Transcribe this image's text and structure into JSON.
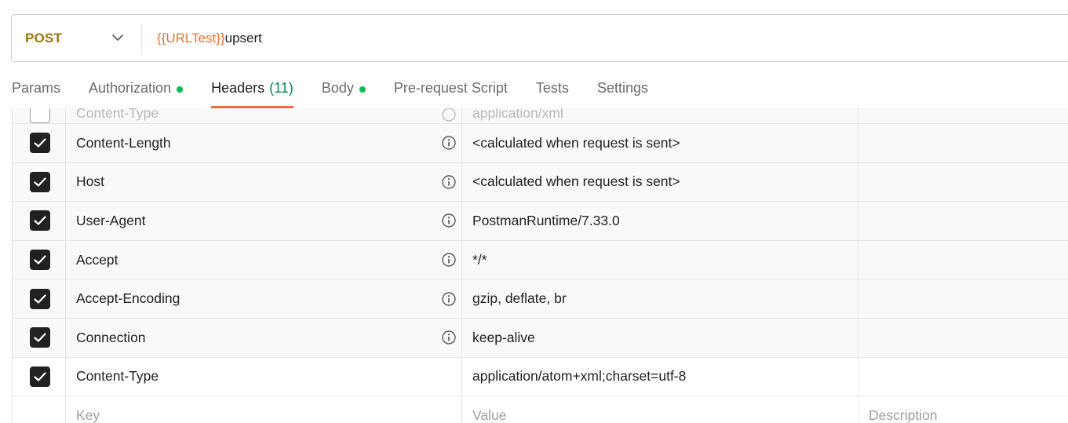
{
  "request": {
    "method": "POST",
    "url_variable": "{{URLTest}}",
    "url_path": "upsert"
  },
  "tabs": [
    {
      "label": "Params",
      "count": "",
      "dot": false,
      "active": false
    },
    {
      "label": "Authorization",
      "count": "",
      "dot": true,
      "active": false
    },
    {
      "label": "Headers",
      "count": "(11)",
      "dot": false,
      "active": true
    },
    {
      "label": "Body",
      "count": "",
      "dot": true,
      "active": false
    },
    {
      "label": "Pre-request Script",
      "count": "",
      "dot": false,
      "active": false
    },
    {
      "label": "Tests",
      "count": "",
      "dot": false,
      "active": false
    },
    {
      "label": "Settings",
      "count": "",
      "dot": false,
      "active": false
    }
  ],
  "headers_partial": {
    "key": "Content-Type",
    "value": "application/xml",
    "checked": false
  },
  "headers": [
    {
      "key": "Content-Length",
      "value": "<calculated when request is sent>",
      "checked": true,
      "info": true
    },
    {
      "key": "Host",
      "value": "<calculated when request is sent>",
      "checked": true,
      "info": true
    },
    {
      "key": "User-Agent",
      "value": "PostmanRuntime/7.33.0",
      "checked": true,
      "info": true
    },
    {
      "key": "Accept",
      "value": "*/*",
      "checked": true,
      "info": true
    },
    {
      "key": "Accept-Encoding",
      "value": "gzip, deflate, br",
      "checked": true,
      "info": true
    },
    {
      "key": "Connection",
      "value": "keep-alive",
      "checked": true,
      "info": true
    },
    {
      "key": "Content-Type",
      "value": "application/atom+xml;charset=utf-8",
      "checked": true,
      "info": false
    }
  ],
  "new_row": {
    "key_placeholder": "Key",
    "value_placeholder": "Value",
    "description_placeholder": "Description"
  },
  "colors": {
    "method": "#a0760b",
    "variable": "#f2702f",
    "active_tab_underline": "#f26b3a",
    "status_dot": "#0cbb52",
    "count": "#0a8a4a"
  }
}
